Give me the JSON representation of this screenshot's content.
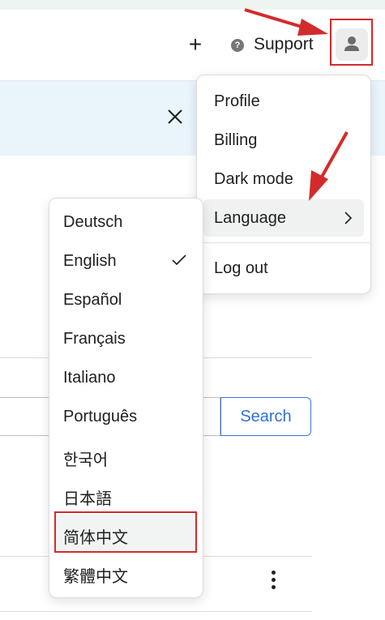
{
  "header": {
    "plus_icon": "plus-icon",
    "support_label": "Support",
    "help_icon": "question-circle-icon",
    "avatar_icon": "user-avatar-icon"
  },
  "banner": {
    "close_icon": "close-icon"
  },
  "search": {
    "button_label": "Search",
    "value": "",
    "placeholder": ""
  },
  "account_menu": {
    "items": [
      {
        "label": "Profile"
      },
      {
        "label": "Billing"
      },
      {
        "label": "Dark mode"
      },
      {
        "label": "Language",
        "submenu": true,
        "highlighted": true
      },
      {
        "label": "Log out"
      }
    ]
  },
  "language_menu": {
    "items": [
      {
        "label": "Deutsch"
      },
      {
        "label": "English",
        "selected": true
      },
      {
        "label": "Español"
      },
      {
        "label": "Français"
      },
      {
        "label": "Italiano"
      },
      {
        "label": "Português"
      },
      {
        "label": "한국어"
      },
      {
        "label": "日本語"
      },
      {
        "label": "简体中文",
        "highlighted": true
      },
      {
        "label": "繁體中文"
      }
    ]
  },
  "colors": {
    "annotation_red": "#d32b2b",
    "link_blue": "#2f6fdc",
    "banner_bg": "#e9f4fb"
  }
}
